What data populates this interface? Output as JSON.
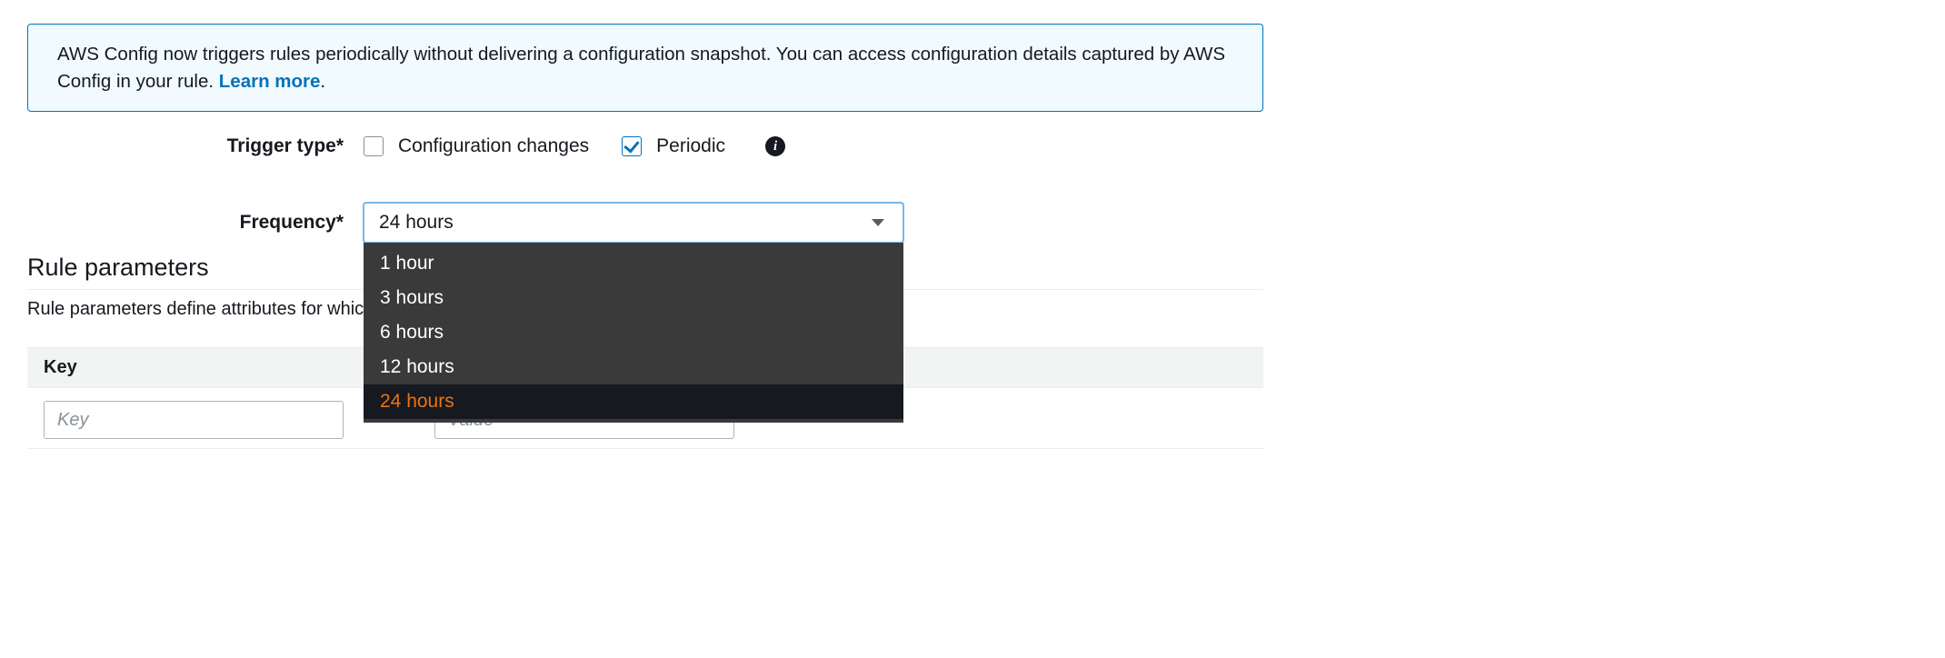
{
  "banner": {
    "text": "AWS Config now triggers rules periodically without delivering a configuration snapshot. You can access configuration details captured by AWS Config in your rule. ",
    "link": "Learn more"
  },
  "trigger": {
    "label": "Trigger type*",
    "config_changes": "Configuration changes",
    "periodic": "Periodic"
  },
  "frequency": {
    "label": "Frequency*",
    "selected": "24 hours",
    "options": [
      "1 hour",
      "3 hours",
      "6 hours",
      "12 hours",
      "24 hours"
    ]
  },
  "params": {
    "heading": "Rule parameters",
    "description": "Rule parameters define attributes for which",
    "key_header": "Key",
    "key_placeholder": "Key",
    "value_placeholder": "Value"
  }
}
